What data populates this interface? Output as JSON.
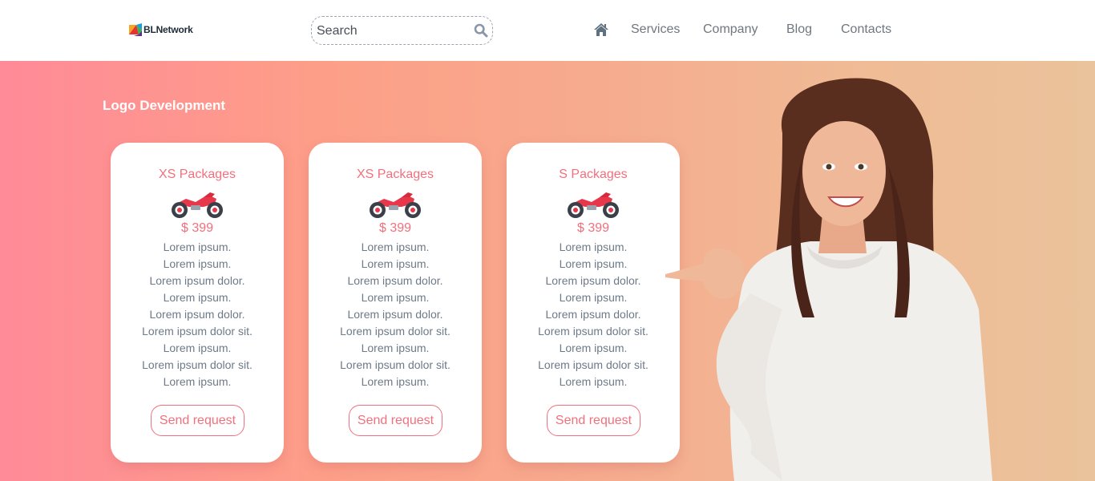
{
  "header": {
    "logo_text": "BLNetwork",
    "search": {
      "placeholder": "Search",
      "value": ""
    },
    "nav": {
      "home_icon": "home-icon",
      "items": [
        {
          "label": "Services"
        },
        {
          "label": "Company"
        },
        {
          "label": "Blog"
        },
        {
          "label": "Contacts"
        }
      ]
    }
  },
  "hero": {
    "title": "Logo Development",
    "cards": [
      {
        "title": "XS Packages",
        "icon": "motorcycle-icon",
        "price": "$ 399",
        "features": [
          "Lorem ipsum.",
          "Lorem ipsum.",
          "Lorem ipsum dolor.",
          "Lorem ipsum.",
          "Lorem ipsum dolor.",
          "Lorem ipsum dolor sit.",
          "Lorem ipsum.",
          "Lorem ipsum dolor sit.",
          "Lorem ipsum."
        ],
        "button": "Send request"
      },
      {
        "title": "XS Packages",
        "icon": "motorcycle-icon",
        "price": "$ 399",
        "features": [
          "Lorem ipsum.",
          "Lorem ipsum.",
          "Lorem ipsum dolor.",
          "Lorem ipsum.",
          "Lorem ipsum dolor.",
          "Lorem ipsum dolor sit.",
          "Lorem ipsum.",
          "Lorem ipsum dolor sit.",
          "Lorem ipsum."
        ],
        "button": "Send request"
      },
      {
        "title": "S Packages",
        "icon": "motorcycle-icon",
        "price": "$ 399",
        "features": [
          "Lorem ipsum.",
          "Lorem ipsum.",
          "Lorem ipsum dolor.",
          "Lorem ipsum.",
          "Lorem ipsum dolor.",
          "Lorem ipsum dolor sit.",
          "Lorem ipsum.",
          "Lorem ipsum dolor sit.",
          "Lorem ipsum."
        ],
        "button": "Send request"
      }
    ]
  },
  "colors": {
    "accent": "#f2707d",
    "text_muted": "#6d7a88",
    "nav_text": "#6f7780",
    "gradient_start": "#ff8a98",
    "gradient_end": "#eac29b"
  }
}
